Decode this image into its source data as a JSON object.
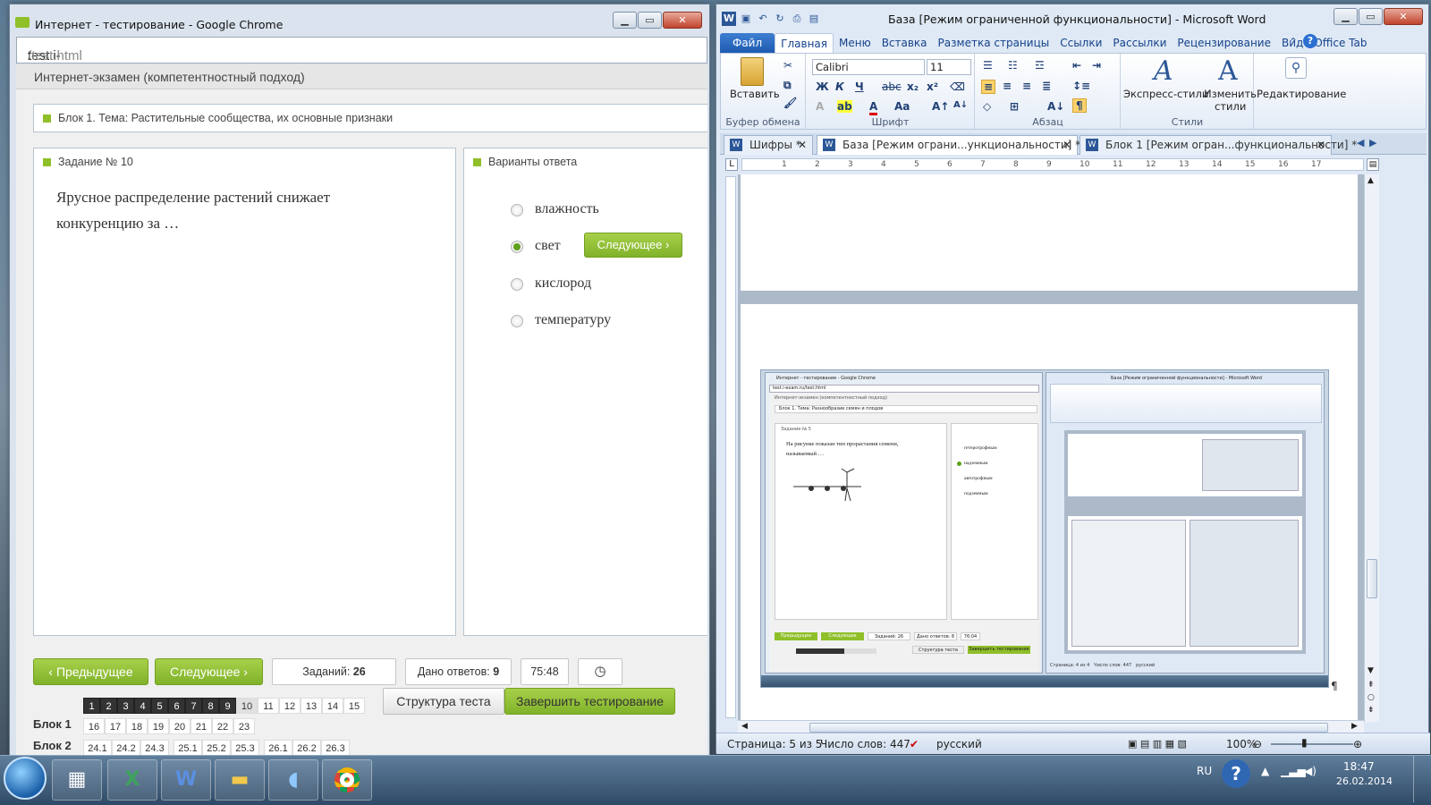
{
  "chrome": {
    "title": "Интернет - тестирование - Google Chrome",
    "url_host": "test.i-exam.ru",
    "url_path": "/test.html",
    "page_header": "Интернет-экзамен (компетентностный подход)",
    "block_title": "Блок 1. Тема: Растительные сообщества, их основные признаки",
    "task_label": "Задание № 10",
    "question": "Ярусное распределение растений снижает конкуренцию за …",
    "answers_label": "Варианты ответа",
    "options": [
      "влажность",
      "свет",
      "кислород",
      "температуру"
    ],
    "selected_index": 1,
    "next_inline": "Следующее",
    "prev_button": "Предыдущее",
    "next_button": "Следующее",
    "tasks_label": "Заданий:",
    "tasks_count": "26",
    "answered_label": "Дано ответов:",
    "answered_count": "9",
    "timer": "75:48",
    "structure_button": "Структура теста",
    "finish_button": "Завершить тестирование",
    "nav_row1": [
      "1",
      "2",
      "3",
      "4",
      "5",
      "6",
      "7",
      "8",
      "9",
      "10",
      "11",
      "12",
      "13",
      "14",
      "15"
    ],
    "nav_row1_done": 9,
    "nav_row1_current": 10,
    "block1_label": "Блок 1",
    "block1_items": [
      "16",
      "17",
      "18",
      "19",
      "20",
      "21",
      "22",
      "23"
    ],
    "block2_label": "Блок 2",
    "block2_items": [
      "24.1",
      "24.2",
      "24.3",
      "25.1",
      "25.2",
      "25.3",
      "26.1",
      "26.2",
      "26.3"
    ]
  },
  "word": {
    "title": "База [Режим ограниченной функциональности] - Microsoft Word",
    "tabs": [
      "Файл",
      "Главная",
      "Меню",
      "Вставка",
      "Разметка страницы",
      "Ссылки",
      "Рассылки",
      "Рецензирование",
      "Вид",
      "Office Tab"
    ],
    "active_tab": 1,
    "paste_label": "Вставить",
    "clipboard_label": "Буфер обмена",
    "font_name": "Calibri",
    "font_size": "11",
    "font_group_label": "Шрифт",
    "paragraph_label": "Абзац",
    "styles_express": "Экспресс-стили",
    "styles_change_1": "Изменить",
    "styles_change_2": "стили",
    "styles_label": "Стили",
    "editing_label": "Редактирование",
    "doc_tabs": [
      {
        "label": "Шифры *",
        "active": false
      },
      {
        "label": "База [Режим ограни...ункциональности] *",
        "active": true
      },
      {
        "label": "Блок 1 [Режим огран...функциональности] *",
        "active": false
      }
    ],
    "ruler_numbers": [
      "1",
      "2",
      "3",
      "4",
      "5",
      "6",
      "7",
      "8",
      "9",
      "10",
      "11",
      "12",
      "13",
      "14",
      "15",
      "16",
      "17"
    ],
    "status_page": "Страница: 5 из 5",
    "status_words": "Число слов: 447",
    "status_lang": "русский",
    "zoom": "100%",
    "embedded": {
      "chrome_title": "Интернет - тестирование - Google Chrome",
      "url": "test.i-exam.ru/test.html",
      "header": "Интернет-экзамен (компетентностный подход)",
      "block": "Блок 1. Тема: Разнообразие семян и плодов",
      "task": "Задание № 5",
      "question": "На рисунке показан тип прорастания семени, называемый …",
      "options": [
        "гетеротрофным",
        "надземным",
        "автотрофным",
        "подземным"
      ],
      "prev": "Предыдущее",
      "next": "Следующее",
      "tasks": "Заданий: 26",
      "answered": "Дано ответов: 8",
      "timer": "76:04",
      "structure": "Структура теста",
      "finish": "Завершить тестирование",
      "word_title": "База [Режим ограниченной функциональности] - Microsoft Word",
      "status_page": "Страница: 4 из 4",
      "status_words": "Число слов: 447",
      "status_lang": "русский"
    }
  },
  "taskbar": {
    "lang": "RU",
    "time": "18:47",
    "date": "26.02.2014",
    "apps": [
      "calculator-icon",
      "excel-icon",
      "word-icon",
      "explorer-icon",
      "media-icon",
      "chrome-icon"
    ]
  }
}
